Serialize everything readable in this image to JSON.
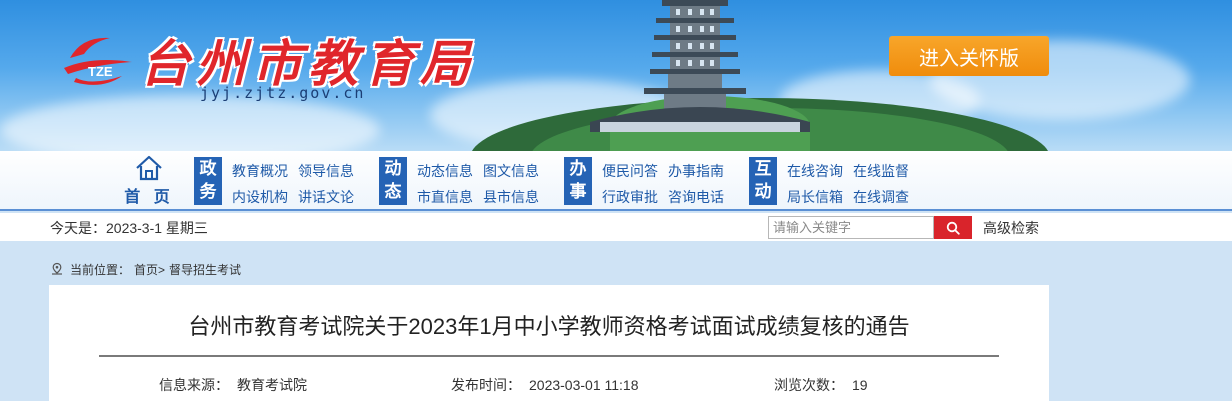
{
  "header": {
    "site_title": "台州市教育局",
    "logo_mark_text": "TZE",
    "domain": "jyj.zjtz.gov.cn",
    "care_button_label": "进入关怀版"
  },
  "nav": {
    "home_label": "首 页",
    "groups": [
      {
        "badge_top": "政",
        "badge_bottom": "务",
        "links": [
          "教育概况",
          "领导信息",
          "内设机构",
          "讲话文论"
        ]
      },
      {
        "badge_top": "动",
        "badge_bottom": "态",
        "links": [
          "动态信息",
          "图文信息",
          "市直信息",
          "县市信息"
        ]
      },
      {
        "badge_top": "办",
        "badge_bottom": "事",
        "links": [
          "便民问答",
          "办事指南",
          "行政审批",
          "咨询电话"
        ]
      },
      {
        "badge_top": "互",
        "badge_bottom": "动",
        "links": [
          "在线咨询",
          "在线监督",
          "局长信箱",
          "在线调查"
        ]
      }
    ]
  },
  "toolbar": {
    "today": "今天是：2023-3-1 星期三",
    "search_placeholder": "请输入关键字",
    "advanced_search_label": "高级检索"
  },
  "breadcrumb": {
    "prefix": "当前位置：",
    "home": "首页>",
    "current": "督导招生考试"
  },
  "article": {
    "title": "台州市教育考试院关于2023年1月中小学教师资格考试面试成绩复核的通告",
    "source_label": "信息来源：",
    "source_value": "教育考试院",
    "published_label": "发布时间：",
    "published_value": "2023-03-01 11:18",
    "views_label": "浏览次数：",
    "views_value": "19"
  },
  "colors": {
    "brand_red": "#e0262b",
    "nav_blue": "#2563b5",
    "care_orange": "#f08c0c",
    "search_red": "#d9242b",
    "page_bg": "#cfe3f5"
  },
  "icons": {
    "home": "home-icon",
    "search": "search-icon",
    "location": "location-pin-icon"
  }
}
